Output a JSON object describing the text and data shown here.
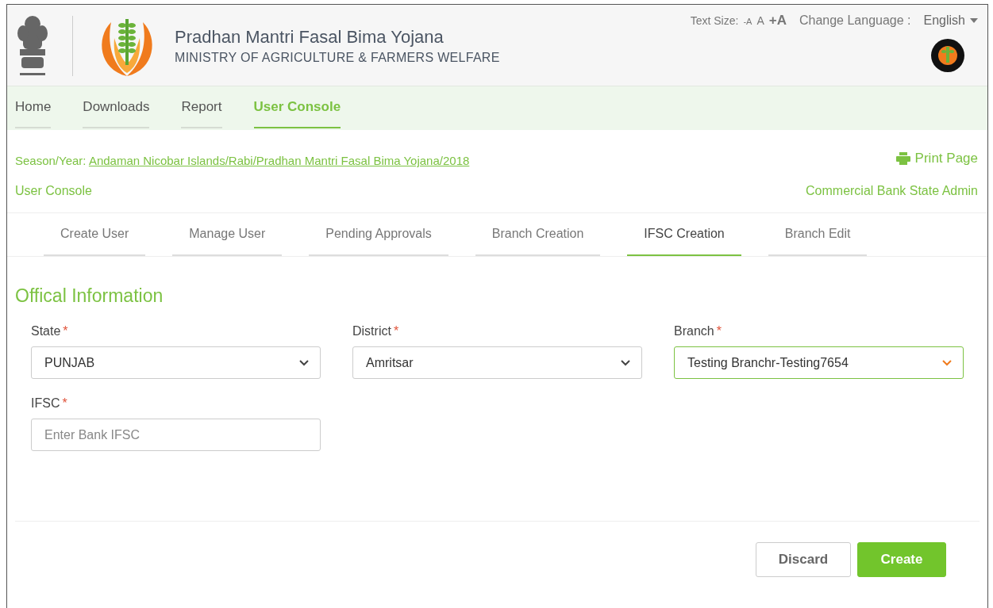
{
  "header": {
    "title": "Pradhan Mantri Fasal Bima Yojana",
    "subtitle": "MINISTRY OF AGRICULTURE & FARMERS WELFARE",
    "text_size_label": "Text Size:",
    "text_size_options": [
      "-A",
      "A",
      "+A"
    ],
    "language_label": "Change Language :",
    "language": "English"
  },
  "nav": [
    {
      "label": "Home",
      "selected": false
    },
    {
      "label": "Downloads",
      "selected": false
    },
    {
      "label": "Report",
      "selected": false
    },
    {
      "label": "User Console",
      "selected": true
    }
  ],
  "context": {
    "season_label": "Season/Year:",
    "season_value": "Andaman Nicobar Islands/Rabi/Pradhan Mantri Fasal Bima Yojana/2018",
    "print": "Print Page",
    "section": "User Console",
    "role": "Commercial Bank State Admin"
  },
  "tabs": [
    {
      "label": "Create User",
      "selected": false
    },
    {
      "label": "Manage User",
      "selected": false
    },
    {
      "label": "Pending Approvals",
      "selected": false
    },
    {
      "label": "Branch Creation",
      "selected": false
    },
    {
      "label": "IFSC Creation",
      "selected": true
    },
    {
      "label": "Branch Edit",
      "selected": false
    }
  ],
  "form": {
    "title": "Offical Information",
    "fields": [
      {
        "kind": "select",
        "label": "State",
        "required": "*",
        "value": "PUNJAB",
        "focused": false
      },
      {
        "kind": "select",
        "label": "District",
        "required": "*",
        "value": "Amritsar",
        "focused": false
      },
      {
        "kind": "select",
        "label": "Branch",
        "required": "*",
        "value": "Testing Branchr-Testing7654",
        "focused": true
      },
      {
        "kind": "text",
        "label": "IFSC",
        "required": "*",
        "placeholder": "Enter Bank IFSC",
        "focused": false
      }
    ]
  },
  "buttons": [
    {
      "label": "Discard",
      "kind": "secondary"
    },
    {
      "label": "Create",
      "kind": "primary"
    }
  ]
}
